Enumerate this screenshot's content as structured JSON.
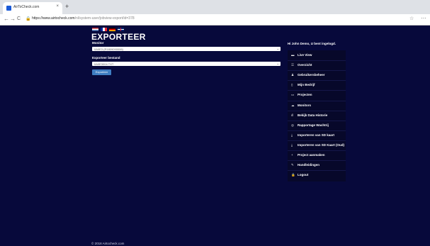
{
  "browser": {
    "tab_title": "AirToCheck.com",
    "tab_close": "×",
    "new_tab": "+",
    "back": "←",
    "forward": "→",
    "reload": "C",
    "url_host": "https://www.airtocheck.com",
    "url_path": "/nl/system-user/jobview-export/id=378",
    "bookmark": "☆",
    "menu": "⋯"
  },
  "page": {
    "title": "EXPORTEER",
    "monitor_label": "Monitor",
    "monitor_value": "0A0E3 (R1809090006)",
    "file_label": "Exporteer bestand",
    "file_value": "0A0E3004.TXT",
    "export_button": "Exporteer",
    "greeting": "Hi John Demo, U bent ingelogd.",
    "footer": "© 2018 Airtocheck.com"
  },
  "flags": [
    "nl-flag-icon",
    "fr-flag-icon",
    "de-flag-icon",
    "gb-flag-icon"
  ],
  "menu": [
    {
      "icon": "▬",
      "label": "Live View"
    },
    {
      "icon": "☰",
      "label": "Overzicht"
    },
    {
      "icon": "♟",
      "label": "Gebruikersbeheer"
    },
    {
      "icon": "▯",
      "label": "Mijn Bedrijf"
    },
    {
      "icon": "▭",
      "label": "Projecten"
    },
    {
      "icon": "☁",
      "label": "Monitors"
    },
    {
      "icon": "ıll",
      "label": "Bekijk Data Historie"
    },
    {
      "icon": "◎",
      "label": "Rapportage Wachtrij"
    },
    {
      "icon": "⤓",
      "label": "Importeren van SD kaart"
    },
    {
      "icon": "⤓",
      "label": "Importeren van SD Kaart (Oud)"
    },
    {
      "icon": "+",
      "label": "Project aanmaken"
    },
    {
      "icon": "✎",
      "label": "Handleidingen"
    },
    {
      "icon": "🔒",
      "label": "Logout"
    }
  ],
  "colors": {
    "background": "#07093b",
    "menu_background": "#07082a",
    "button": "#3f7ec3"
  }
}
